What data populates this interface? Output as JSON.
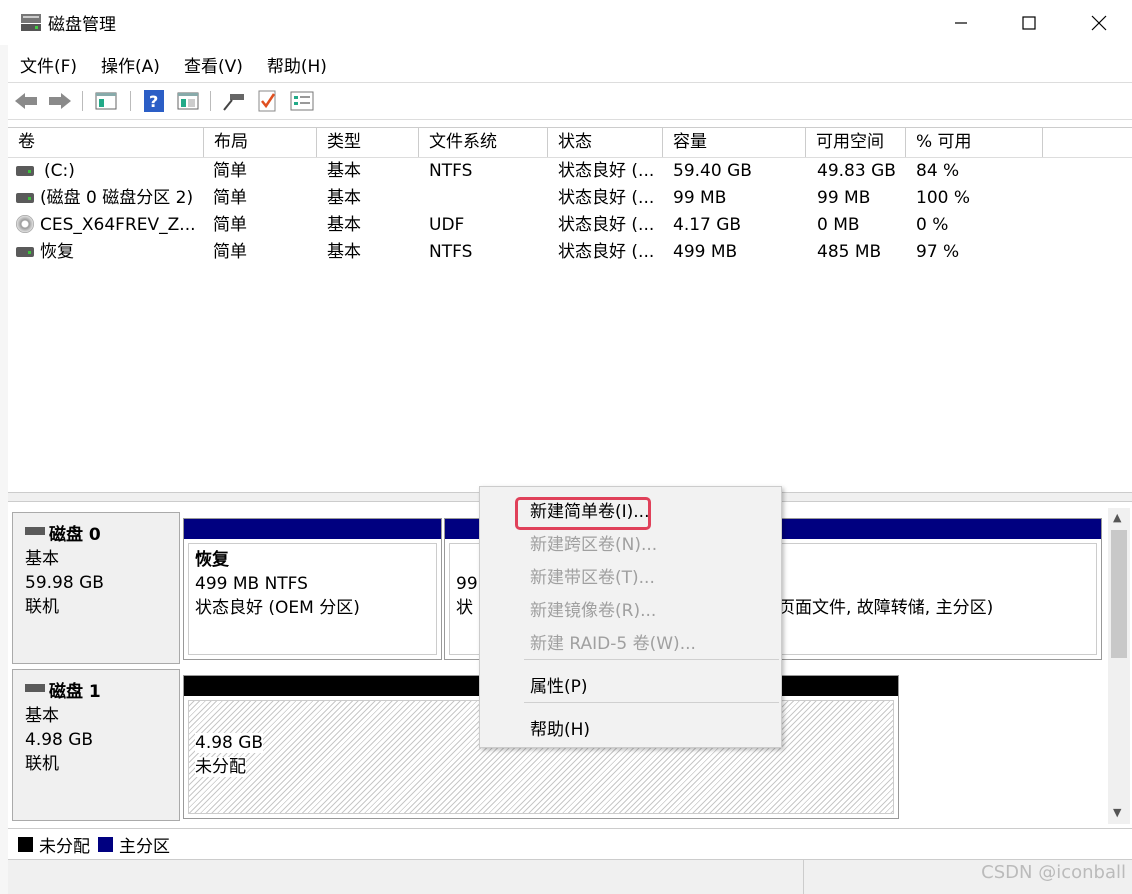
{
  "window": {
    "title": "磁盘管理",
    "minimize": "—",
    "maximize": "☐",
    "close": "✕"
  },
  "menu": [
    "文件(F)",
    "操作(A)",
    "查看(V)",
    "帮助(H)"
  ],
  "toolbar_icons": [
    "back-icon",
    "forward-icon",
    "console-tree-icon",
    "help-icon",
    "show-hide-icon",
    "connect-icon",
    "check-icon",
    "properties-icon"
  ],
  "columns": [
    "卷",
    "布局",
    "类型",
    "文件系统",
    "状态",
    "容量",
    "可用空间",
    "% 可用"
  ],
  "volumes": [
    {
      "icon": "drive",
      "name": "(C:)",
      "layout": "简单",
      "type": "基本",
      "fs": "NTFS",
      "status": "状态良好 (...",
      "capacity": "59.40 GB",
      "free": "49.83 GB",
      "pct": "84 %"
    },
    {
      "icon": "drive",
      "name": "(磁盘 0 磁盘分区 2)",
      "layout": "简单",
      "type": "基本",
      "fs": "",
      "status": "状态良好 (...",
      "capacity": "99 MB",
      "free": "99 MB",
      "pct": "100 %"
    },
    {
      "icon": "cd",
      "name": "CES_X64FREV_Z...",
      "layout": "简单",
      "type": "基本",
      "fs": "UDF",
      "status": "状态良好 (...",
      "capacity": "4.17 GB",
      "free": "0 MB",
      "pct": "0 %"
    },
    {
      "icon": "drive",
      "name": "恢复",
      "layout": "简单",
      "type": "基本",
      "fs": "NTFS",
      "status": "状态良好 (...",
      "capacity": "499 MB",
      "free": "485 MB",
      "pct": "97 %"
    }
  ],
  "disk0": {
    "name": "磁盘 0",
    "type": "基本",
    "size": "59.98 GB",
    "state": "联机",
    "p1": {
      "title": "恢复",
      "line2": "499 MB NTFS",
      "line3": "状态良好 (OEM 分区)"
    },
    "p2": {
      "line2": "99",
      "line3": "状"
    },
    "p3": {
      "line3": "页面文件, 故障转储, 主分区)"
    }
  },
  "disk1": {
    "name": "磁盘 1",
    "type": "基本",
    "size": "4.98 GB",
    "state": "联机",
    "p1": {
      "line2": "4.98 GB",
      "line3": "未分配"
    }
  },
  "legend": {
    "unallocated": "未分配",
    "primary": "主分区"
  },
  "colors": {
    "unallocated": "#000000",
    "primary": "#000080",
    "highlight": "#e0415a"
  },
  "context_menu": {
    "items": [
      {
        "label": "新建简单卷(I)...",
        "enabled": true
      },
      {
        "label": "新建跨区卷(N)...",
        "enabled": false
      },
      {
        "label": "新建带区卷(T)...",
        "enabled": false
      },
      {
        "label": "新建镜像卷(R)...",
        "enabled": false
      },
      {
        "label": "新建 RAID-5 卷(W)...",
        "enabled": false
      },
      {
        "label": "属性(P)",
        "enabled": true
      },
      {
        "label": "帮助(H)",
        "enabled": true
      }
    ]
  },
  "watermark": "CSDN @iconball"
}
